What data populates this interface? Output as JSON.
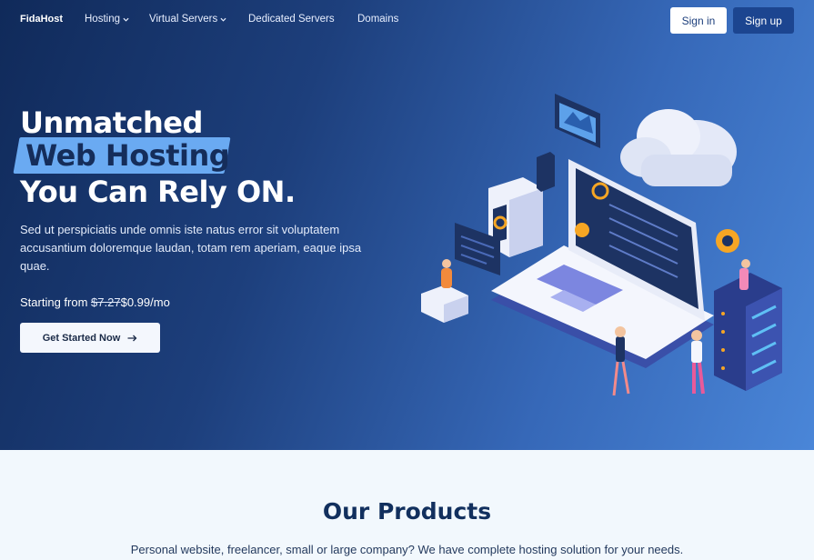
{
  "nav": {
    "brand": "FidaHost",
    "links": [
      {
        "label": "Hosting",
        "dropdown": true
      },
      {
        "label": "Virtual Servers",
        "dropdown": true
      },
      {
        "label": "Dedicated Servers",
        "dropdown": false
      },
      {
        "label": "Domains",
        "dropdown": false
      }
    ],
    "signin": "Sign in",
    "signup": "Sign up"
  },
  "hero": {
    "line1": "Unmatched",
    "line2": "Web Hosting",
    "line3": "You Can Rely ON.",
    "description": "Sed ut perspiciatis unde omnis iste natus error sit voluptatem accusantium doloremque laudan, totam rem aperiam, eaque ipsa quae.",
    "price_prefix": "Starting from",
    "price_old": "$7.27",
    "price_new": "$0.99/mo",
    "cta": "Get Started Now",
    "cta_icon": "arrow-right-icon"
  },
  "products": {
    "title": "Our Products",
    "subtitle": "Personal website, freelancer, small or large company? We have complete hosting solution for your needs."
  },
  "colors": {
    "hero_dark": "#102a5a",
    "hero_light": "#4a86d8",
    "highlight": "#6aaaf2",
    "signup_bg": "#1c4590",
    "section_bg": "#f2f8fd",
    "title": "#12305e"
  }
}
